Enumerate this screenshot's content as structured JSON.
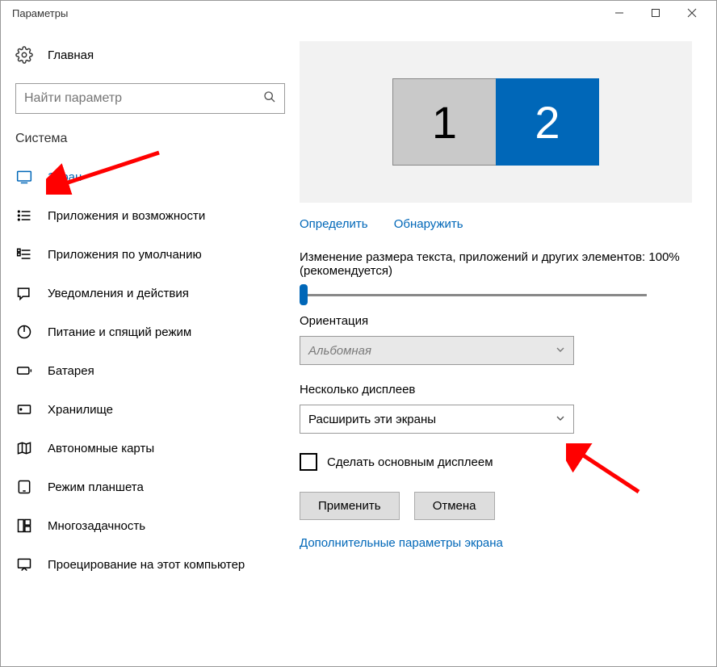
{
  "window": {
    "title": "Параметры"
  },
  "sidebar": {
    "home_label": "Главная",
    "search_placeholder": "Найти параметр",
    "section_label": "Система",
    "items": [
      {
        "label": "Экран"
      },
      {
        "label": "Приложения и возможности"
      },
      {
        "label": "Приложения по умолчанию"
      },
      {
        "label": "Уведомления и действия"
      },
      {
        "label": "Питание и спящий режим"
      },
      {
        "label": "Батарея"
      },
      {
        "label": "Хранилище"
      },
      {
        "label": "Автономные карты"
      },
      {
        "label": "Режим планшета"
      },
      {
        "label": "Многозадачность"
      },
      {
        "label": "Проецирование на этот компьютер"
      }
    ]
  },
  "main": {
    "monitor1": "1",
    "monitor2": "2",
    "identify_label": "Определить",
    "detect_label": "Обнаружить",
    "scale_text": "Изменение размера текста, приложений и других элементов: 100% (рекомендуется)",
    "orientation_label": "Ориентация",
    "orientation_value": "Альбомная",
    "multiple_label": "Несколько дисплеев",
    "multiple_value": "Расширить эти экраны",
    "make_main_label": "Сделать основным дисплеем",
    "apply_label": "Применить",
    "cancel_label": "Отмена",
    "advanced_label": "Дополнительные параметры экрана"
  }
}
